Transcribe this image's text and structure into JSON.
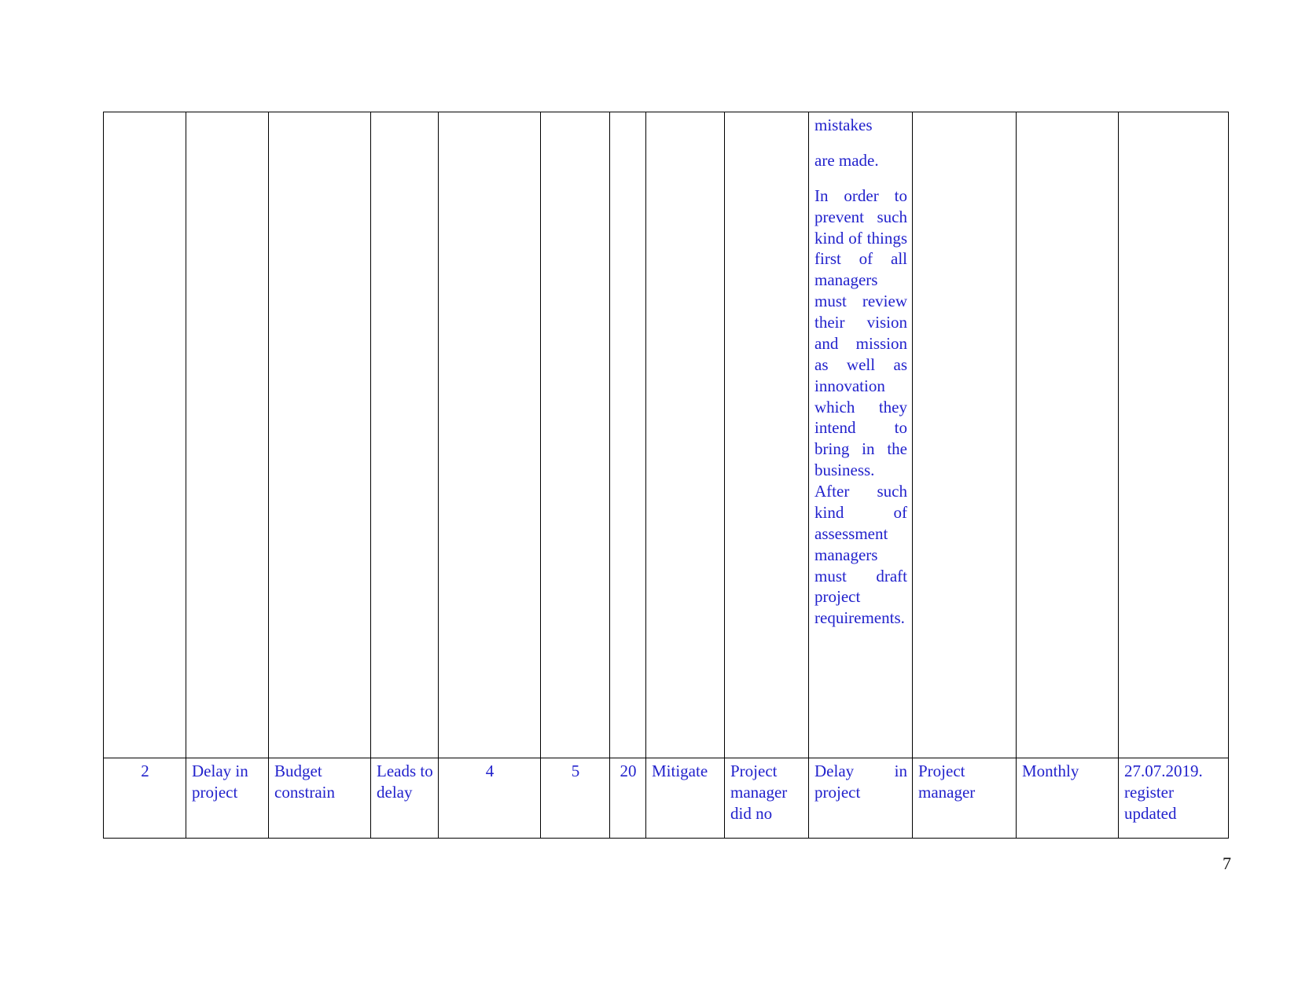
{
  "document": {
    "page_number": "7",
    "text_color": "#2222cc",
    "border_color": "#000000"
  },
  "table": {
    "continuation_row": {
      "risk_response_cell": {
        "para1": "mistakes",
        "para2": "are made.",
        "para3": "In order to prevent such kind of things first of all managers must review their vision and mission as well as innovation which they intend to bring in the business. After such kind of assessment managers must draft project requirements."
      }
    },
    "rows": [
      {
        "id": "2",
        "risk": "Delay in project",
        "cause": "Budget constrain",
        "effect": "Leads to delay",
        "probability": "4",
        "impact": "5",
        "score": "20",
        "response": "Mitigate",
        "owner_action": "Project manager did no",
        "description": "Delay in project",
        "owner": "Project manager",
        "review": "Monthly",
        "status_date": "27.07.2019. register updated"
      }
    ]
  }
}
